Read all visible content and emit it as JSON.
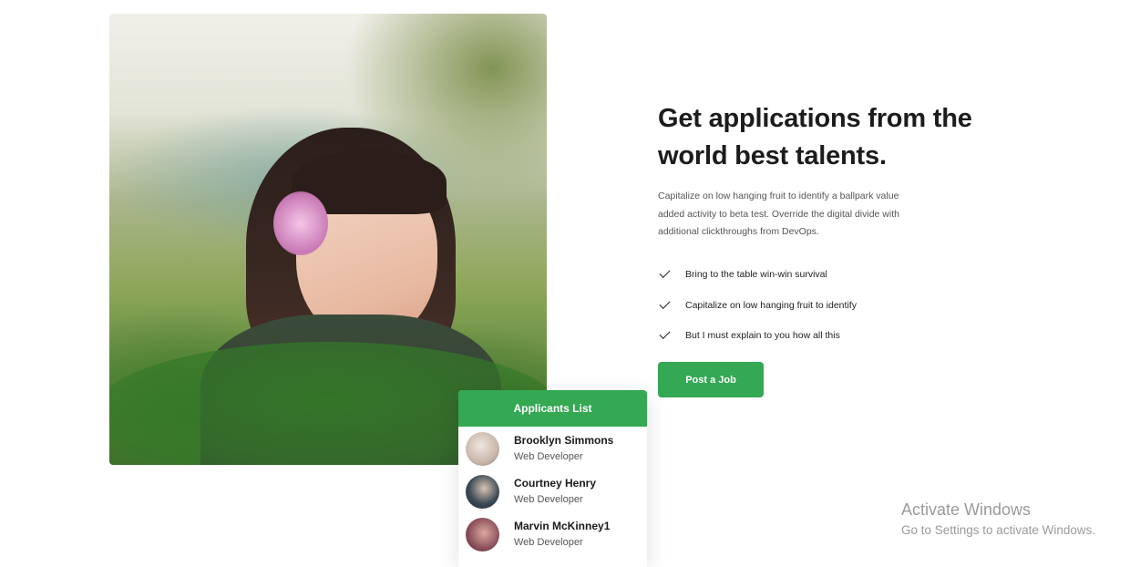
{
  "hero": {
    "heading": "Get applications from the world best talents.",
    "description": "Capitalize on low hanging fruit to identify a ballpark value added activity to beta test. Override the digital divide with additional clickthroughs from DevOps.",
    "checklist": [
      "Bring to the table win-win survival",
      "Capitalize on low hanging fruit to identify",
      "But I must explain to you how all this"
    ],
    "button_label": "Post a Job"
  },
  "applicants": {
    "title": "Applicants List",
    "list": [
      {
        "name": "Brooklyn Simmons",
        "role": "Web Developer"
      },
      {
        "name": "Courtney Henry",
        "role": "Web Developer"
      },
      {
        "name": "Marvin McKinney1",
        "role": "Web Developer"
      }
    ]
  },
  "watermark": {
    "line1": "Activate Windows",
    "line2": "Go to Settings to activate Windows."
  },
  "colors": {
    "accent": "#34a853",
    "heading": "#1c1c1c",
    "text": "#555555"
  }
}
